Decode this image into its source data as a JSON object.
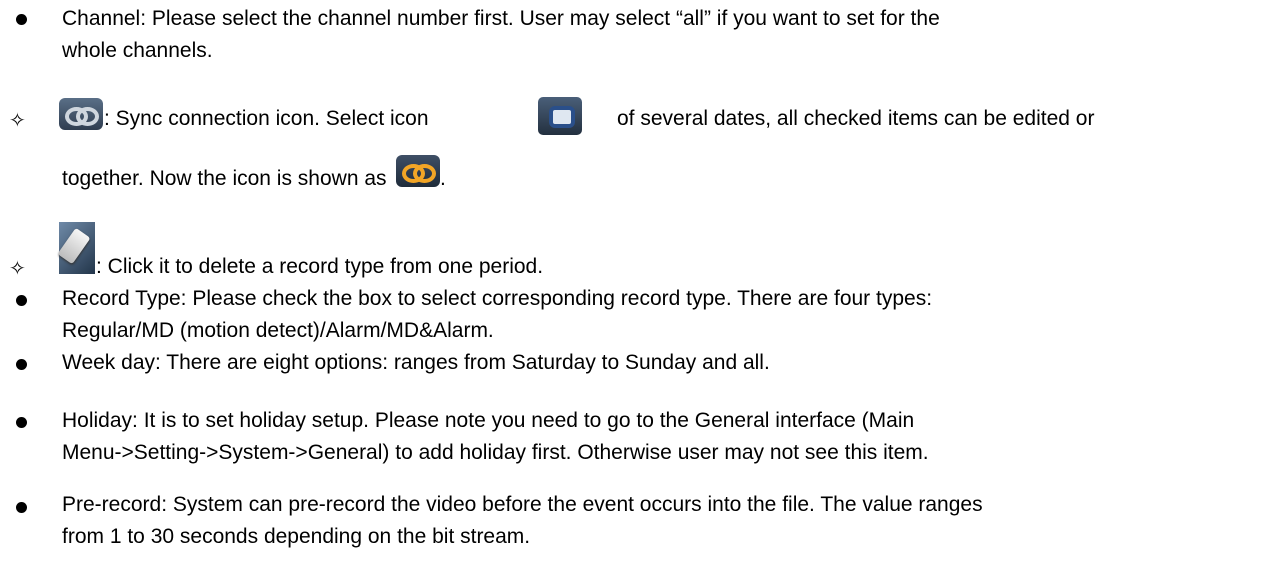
{
  "items": [
    {
      "marker": "bullet",
      "lines": [
        "Channel: Please select the channel number first. User may select “all” if you want to set for the",
        "whole channels."
      ]
    },
    {
      "marker": "diamond",
      "symbol": "✧",
      "icon_before": "sync-connection-icon",
      "text_a": ": Sync connection icon. Select icon",
      "icon_mid": "checkbox-icon",
      "text_b": "of several dates, all checked items can be edited or",
      "text_c": "together. Now the icon is shown as",
      "icon_end": "sync-connection-active-icon",
      "text_end": "."
    },
    {
      "marker": "diamond",
      "symbol": "✧",
      "icon_before": "eraser-icon",
      "text": ": Click it to delete a record type from one period."
    },
    {
      "marker": "bullet",
      "lines": [
        "Record Type: Please check the box to select corresponding record type. There are four types:",
        "Regular/MD (motion detect)/Alarm/MD&Alarm."
      ]
    },
    {
      "marker": "bullet",
      "lines": [
        "Week day: There are eight options: ranges from Saturday to Sunday and all."
      ]
    },
    {
      "marker": "bullet",
      "lines": [
        "Holiday: It is to set holiday setup. Please note you need to go to the General interface (Main",
        "Menu->Setting->System->General) to add holiday first. Otherwise user may not see this item."
      ]
    },
    {
      "marker": "bullet",
      "lines": [
        "Pre-record: System can pre-record the video before the event occurs into the file. The value ranges",
        "from 1 to 30 seconds depending on the bit stream."
      ]
    }
  ],
  "colors": {
    "sync_active": "#f2a526",
    "icon_bg": "#3a4b60"
  }
}
